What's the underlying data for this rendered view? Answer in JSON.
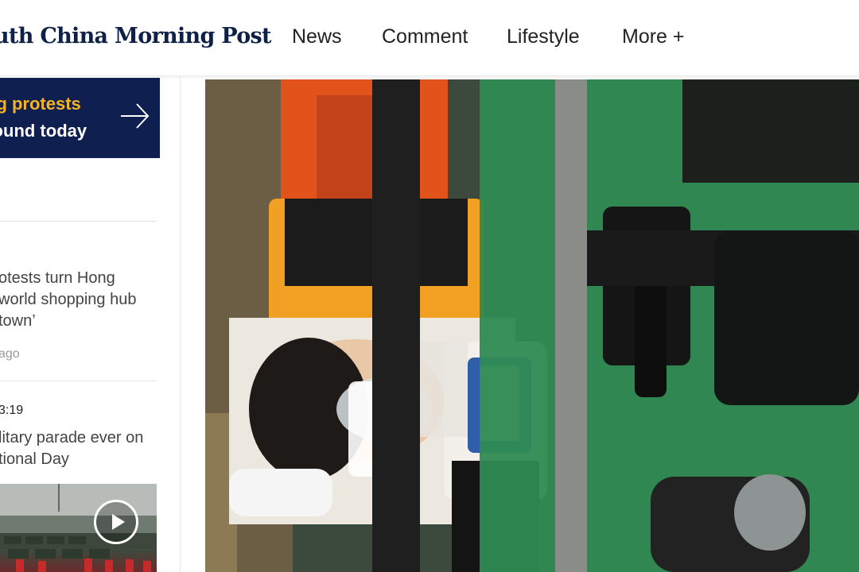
{
  "header": {
    "logo_text": "uth China Morning Post",
    "nav": [
      {
        "label": "News"
      },
      {
        "label": "Comment"
      },
      {
        "label": "Lifestyle"
      },
      {
        "label": "More +"
      }
    ]
  },
  "sidebar": {
    "promo": {
      "line1": "ng protests",
      "line2": "round today"
    },
    "story1": {
      "title_lines": [
        "otests turn Hong",
        " world shopping hub",
        " town’"
      ],
      "meta": "ago"
    },
    "story2": {
      "time": "3:19",
      "title_lines": [
        "litary parade ever on",
        "tional Day"
      ]
    }
  },
  "colors": {
    "brand_navy": "#0f2147",
    "promo_bg": "#0f1f4f",
    "promo_accent": "#f4b324"
  },
  "icons": {
    "promo_arrow": "arrow-right-icon",
    "video_play": "play-icon"
  }
}
